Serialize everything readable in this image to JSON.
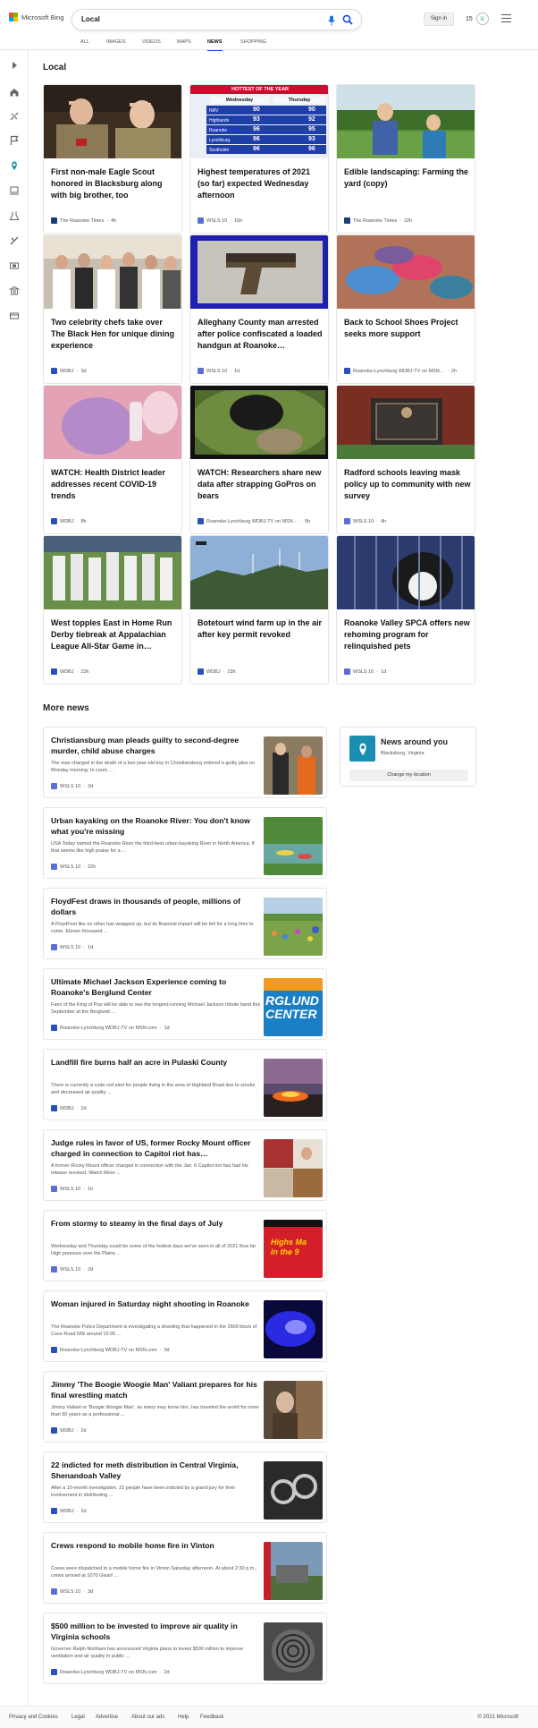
{
  "brand": {
    "name": "Microsoft Bing"
  },
  "search": {
    "query": "Local"
  },
  "header": {
    "signin_label": "Sign in",
    "rewards_count": "15"
  },
  "scopes": [
    {
      "label": "ALL"
    },
    {
      "label": "IMAGES"
    },
    {
      "label": "VIDEOS"
    },
    {
      "label": "MAPS"
    },
    {
      "label": "NEWS"
    },
    {
      "label": "SHOPPING"
    }
  ],
  "local": {
    "title": "Local",
    "cards": [
      {
        "title": "First non-male Eagle Scout honored in Blacksburg along with big brother, too",
        "source": "The Roanoke Times",
        "age": "4h"
      },
      {
        "title": "Highest temperatures of 2021 (so far) expected Wednesday afternoon",
        "source": "WSLS 10",
        "age": "15h"
      },
      {
        "title": "Edible landscaping: Farming the yard (copy)",
        "source": "The Roanoke Times",
        "age": "22h"
      },
      {
        "title": "Two celebrity chefs take over The Black Hen for unique dining experience",
        "source": "WDBJ",
        "age": "3d"
      },
      {
        "title": "Alleghany County man arrested after police confiscated a loaded handgun at Roanoke…",
        "source": "WSLS 10",
        "age": "1d"
      },
      {
        "title": "Back to School Shoes Project seeks more support",
        "source": "Roanoke-Lynchburg WDBJ-TV on MSN…",
        "age": "2h"
      },
      {
        "title": "WATCH: Health District leader addresses recent COVID-19 trends",
        "source": "WDBJ",
        "age": "8h"
      },
      {
        "title": "WATCH: Researchers share new data after strapping GoPros on bears",
        "source": "Roanoke-Lynchburg WDBJ-TV on MSN…",
        "age": "9h"
      },
      {
        "title": "Radford schools leaving mask policy up to community with new survey",
        "source": "WSLS 10",
        "age": "4h"
      },
      {
        "title": "West topples East in Home Run Derby tiebreak at Appalachian League All-Star Game in…",
        "source": "WDBJ",
        "age": "23h"
      },
      {
        "title": "Botetourt wind farm up in the air after key permit revoked",
        "source": "WDBJ",
        "age": "23h"
      },
      {
        "title": "Roanoke Valley SPCA offers new rehoming program for relinquished pets",
        "source": "WSLS 10",
        "age": "1d"
      }
    ],
    "weather_graphic": {
      "banner": "HOTTEST OF THE YEAR",
      "col1": "Wednesday",
      "col2": "Thursday",
      "rows": [
        {
          "city": "NRV",
          "a": "90",
          "b": "90"
        },
        {
          "city": "Highlands",
          "a": "93",
          "b": "92"
        },
        {
          "city": "Roanoke",
          "a": "96",
          "b": "95"
        },
        {
          "city": "Lynchburg",
          "a": "96",
          "b": "93"
        },
        {
          "city": "Southside",
          "a": "96",
          "b": "96"
        }
      ]
    }
  },
  "more_news": {
    "title": "More news",
    "items": [
      {
        "title": "Christiansburg man pleads guilty to second-degree murder, child abuse charges",
        "snippet": "The man charged in the death of a two-year-old boy in Christiansburg entered a guilty plea on Monday morning. In court, ...",
        "source": "WSLS 10",
        "age": "2d"
      },
      {
        "title": "Urban kayaking on the Roanoke River: You don't know what you're missing",
        "snippet": "USA Today named the Roanoke River the third-best urban kayaking River in North America. If that seems like high praise for a ...",
        "source": "WSLS 10",
        "age": "22h"
      },
      {
        "title": "FloydFest draws in thousands of people, millions of dollars",
        "snippet": "A FloydFest like no other has wrapped up, but its financial impact will be felt for a long time to come. Eleven thousand ...",
        "source": "WSLS 10",
        "age": "1d"
      },
      {
        "title": "Ultimate Michael Jackson Experience coming to Roanoke's Berglund Center",
        "snippet": "Fans of the King of Pop will be able to see the longest-running Michael Jackson tribute band this September at the Berglund ...",
        "source": "Roanoke-Lynchburg WDBJ-TV on MSN.com",
        "age": "1d"
      },
      {
        "title": "Landfill fire burns half an acre in Pulaski County",
        "snippet": "There is currently a code red alert for people living in the area of Highland Road due to smoke and decreased air quality ...",
        "source": "WDBJ",
        "age": "2d"
      },
      {
        "title": "Judge rules in favor of US, former Rocky Mount officer charged in connection to Capitol riot has…",
        "snippet": "A former Rocky Mount officer charged in connection with the Jan. 6 Capitol riot has had his release revoked. Watch More ...",
        "source": "WSLS 10",
        "age": "1h"
      },
      {
        "title": "From stormy to steamy in the final days of July",
        "snippet": "Wednesday and Thursday could be some of the hottest days we've seen in all of 2021 thus far. High pressure over the Plains ...",
        "source": "WSLS 10",
        "age": "2d"
      },
      {
        "title": "Woman injured in Saturday night shooting in Roanoke",
        "snippet": "The Roanoke Police Department is investigating a shooting that happened in the 2600 block of Cove Road NW around 10:30 ...",
        "source": "Roanoke-Lynchburg WDBJ-TV on MSN.com",
        "age": "3d"
      },
      {
        "title": "Jimmy 'The Boogie Woogie Man' Valiant prepares for his final wrestling match",
        "snippet": "Jimmy Valiant or 'Boogie Woogie Man', as many may know him, has traveled the world for more than 50 years as a professional ...",
        "source": "WDBJ",
        "age": "2d"
      },
      {
        "title": "22 indicted for meth distribution in Central Virginia, Shenandoah Valley",
        "snippet": "After a 10-month investigation, 22 people have been indicted by a grand jury for their involvement in distributing ...",
        "source": "WDBJ",
        "age": "2d"
      },
      {
        "title": "Crews respond to mobile home fire in Vinton",
        "snippet": "Crews were dispatched to a mobile home fire in Vinton Saturday afternoon. At about 2:30 p.m., crews arrived at 1070 Gwarf ...",
        "source": "WSLS 10",
        "age": "3d"
      },
      {
        "title": "$500 million to be invested to improve air quality in Virginia schools",
        "snippet": "Governor Ralph Northam has announced Virginia plans to invest $500 million to improve ventilation and air quality in public ...",
        "source": "Roanoke-Lynchburg WDBJ-TV on MSN.com",
        "age": "2d"
      }
    ],
    "thumb_texts": {
      "berglund": "RGLUND\nCENTER",
      "steamy": "Highs Ma\nin the 9"
    }
  },
  "news_around": {
    "title": "News around you",
    "location": "Blacksburg, Virginia",
    "button": "Change my location"
  },
  "footer": {
    "links": [
      "Privacy and Cookies",
      "Legal",
      "Advertise",
      "About our ads",
      "Help",
      "Feedback"
    ],
    "copyright": "© 2021 Microsoft"
  },
  "colors": {
    "accent": "#174ae4",
    "teal": "#1a8fb2"
  }
}
